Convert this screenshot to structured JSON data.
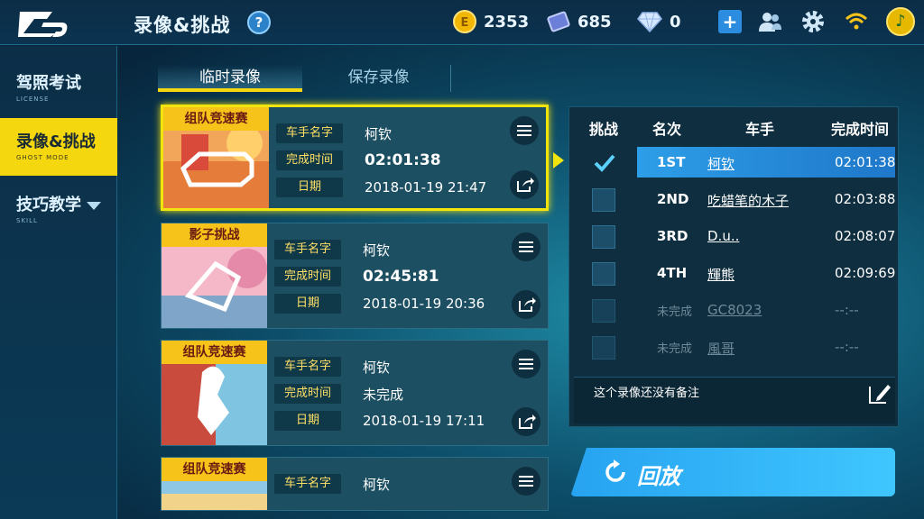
{
  "header": {
    "title": "录像&挑战",
    "help": "?",
    "coins": "2353",
    "tickets": "685",
    "diamonds": "0",
    "plus": "+"
  },
  "sidebar": {
    "items": [
      {
        "label": "驾照考试",
        "sub": "LICENSE"
      },
      {
        "label": "录像&挑战",
        "sub": "GHOST MODE"
      },
      {
        "label": "技巧教学",
        "sub": "SKILL"
      }
    ]
  },
  "tabs": [
    {
      "label": "临时录像"
    },
    {
      "label": "保存录像"
    }
  ],
  "records": [
    {
      "mode": "组队竞速赛",
      "driver_label": "车手名字",
      "driver": "柯钦",
      "time_label": "完成时间",
      "time": "02:01:38",
      "date_label": "日期",
      "date": "2018-01-19   21:47"
    },
    {
      "mode": "影子挑战",
      "driver_label": "车手名字",
      "driver": "柯钦",
      "time_label": "完成时间",
      "time": "02:45:81",
      "date_label": "日期",
      "date": "2018-01-19   20:36"
    },
    {
      "mode": "组队竞速赛",
      "driver_label": "车手名字",
      "driver": "柯钦",
      "time_label": "完成时间",
      "time": "未完成",
      "date_label": "日期",
      "date": "2018-01-19   17:11"
    },
    {
      "mode": "组队竞速赛",
      "driver_label": "车手名字",
      "driver": "柯钦"
    }
  ],
  "panel": {
    "headers": {
      "challenge": "挑战",
      "rank": "名次",
      "driver": "车手",
      "time": "完成时间"
    },
    "rows": [
      {
        "rank": "1ST",
        "name": "柯钦",
        "time": "02:01:38",
        "checked": true
      },
      {
        "rank": "2ND",
        "name": "吃蜡笔的木子",
        "time": "02:03:88",
        "checked": false
      },
      {
        "rank": "3RD",
        "name": "D.u..",
        "time": "02:08:07",
        "checked": false
      },
      {
        "rank": "4TH",
        "name": "輝熊",
        "time": "02:09:69",
        "checked": false
      },
      {
        "rank": "未完成",
        "name": "GC8023",
        "time": "--:--",
        "checked": false
      },
      {
        "rank": "未完成",
        "name": "風哥",
        "time": "--:--",
        "checked": false
      }
    ],
    "note": "这个录像还没有备注"
  },
  "replay": {
    "label": "回放"
  },
  "colors": {
    "accent_yellow": "#f5d70f",
    "highlight_blue": "#2d9ee8",
    "label_yellow": "#ffe066"
  }
}
